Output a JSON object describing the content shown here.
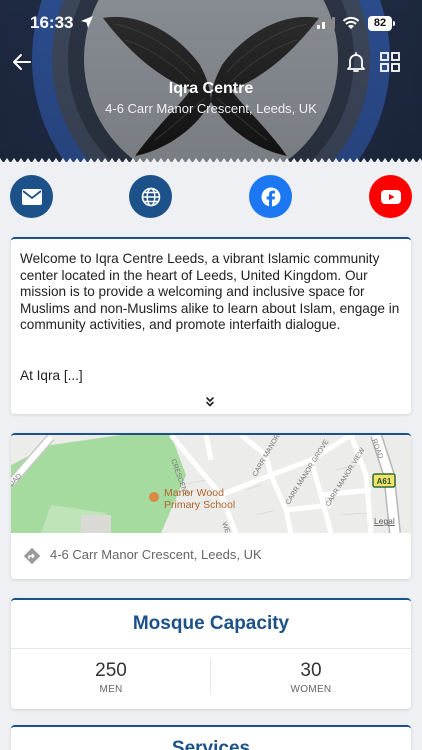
{
  "status_bar": {
    "time": "16:33",
    "battery": "82"
  },
  "header": {
    "title": "Iqra Centre",
    "subtitle": "4-6 Carr Manor Crescent, Leeds, UK"
  },
  "social": [
    {
      "name": "email",
      "icon": "mail-icon",
      "color": "#1c5289"
    },
    {
      "name": "website",
      "icon": "globe-icon",
      "color": "#1c5289"
    },
    {
      "name": "facebook",
      "icon": "facebook-icon",
      "color": "#1b77f2"
    },
    {
      "name": "youtube",
      "icon": "youtube-icon",
      "color": "#ff0000"
    }
  ],
  "about": {
    "text": "Welcome to Iqra Centre Leeds, a vibrant Islamic community center located in the heart of Leeds, United Kingdom. Our mission is to provide a welcoming and inclusive space for Muslims and non-Muslims alike to learn about Islam, engage in community activities, and promote interfaith dialogue.",
    "more": "At Iqra  [...]"
  },
  "map": {
    "labels": {
      "poi": "Manor Wood\nPrimary School",
      "road_a61": "A61",
      "road1": "CARR MANOR",
      "road2": "CARR MANOR GROVE",
      "road3": "CARR MANOR VIEW",
      "road4": "CRESCENT",
      "road5": "OAD",
      "road6": "ROAD",
      "road7": "WE",
      "legal": "Legal"
    },
    "address": "4-6 Carr Manor Crescent, Leeds, UK"
  },
  "capacity": {
    "title": "Mosque Capacity",
    "men_value": "250",
    "men_label": "MEN",
    "women_value": "30",
    "women_label": "WOMEN"
  },
  "services": {
    "title": "Services"
  },
  "colors": {
    "primary": "#1c5289",
    "facebook": "#1b77f2",
    "youtube": "#ff0000",
    "background": "#eef0f4"
  }
}
